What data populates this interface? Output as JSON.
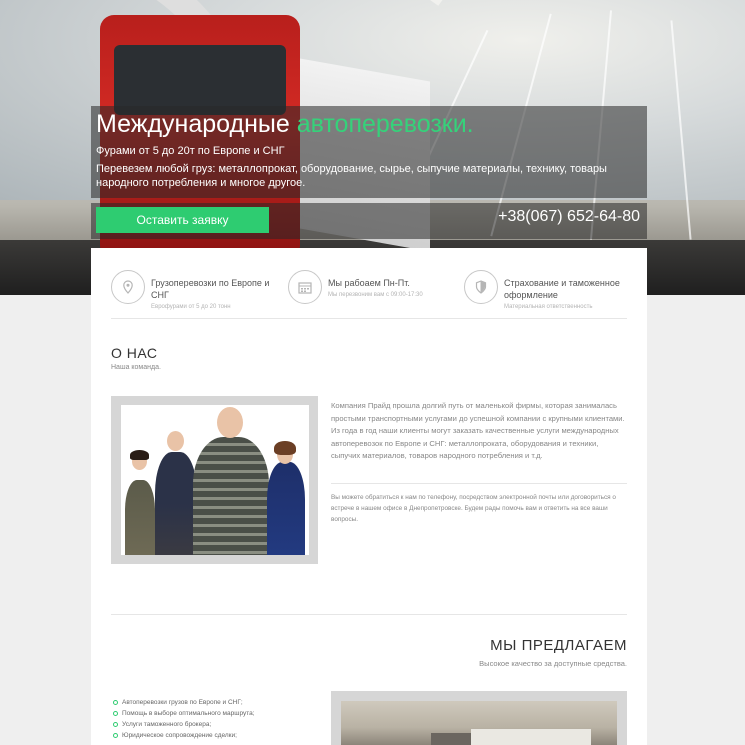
{
  "hero": {
    "title_main": "Международные",
    "title_accent": "автоперевозки.",
    "subtitle": "Фурами от 5 до 20т по Европе и СНГ",
    "description": "Перевезем любой груз: металлопрокат, оборудование, сырье, сыпучие материалы, технику, товары народного потребления и многое другое.",
    "cta_label": "Оставить заявку",
    "phone": "+38(067) 652-64-80"
  },
  "features": [
    {
      "icon": "map-pin-icon",
      "title": "Грузоперевозки по Европе и СНГ",
      "sub": "Еврофурами от 5 до 20 тонн"
    },
    {
      "icon": "calendar-icon",
      "title": "Мы рабоаем Пн-Пт.",
      "sub": "Мы перезвоним вам с 09:00-17:30"
    },
    {
      "icon": "shield-icon",
      "title": "Страхование и таможенное оформление",
      "sub": "Материальная ответственность"
    }
  ],
  "about": {
    "heading": "О НАС",
    "subheading": "Наша команда.",
    "text1": "Компания Прайд прошла долгий путь от маленькой фирмы, которая занималась простыми транспортными услугами до успешной компании с крупными клиентами. Из года в год наши клиенты могут заказать качественные услуги международных автоперевозок по Европе и СНГ: металлопроката, оборудования и техники, сыпучих материалов, товаров народного потребления и т.д.",
    "text2": "Вы можете обратиться к нам по телефону, посредством электронной почты или договориться о встрече в нашем офисе в Днепропетровске. Будем рады помочь вам и ответить на все ваши вопросы."
  },
  "offer": {
    "heading": "МЫ ПРЕДЛАГАЕМ",
    "subheading": "Высокое качество за доступные средства.",
    "items": [
      "Автоперевозки грузов по Европе и СНГ;",
      "Помощь в выборе оптимального маршрута;",
      "Услуги таможенного брокера;",
      "Юридическое сопровождение сделки;"
    ]
  },
  "colors": {
    "accent": "#2ecc71"
  }
}
